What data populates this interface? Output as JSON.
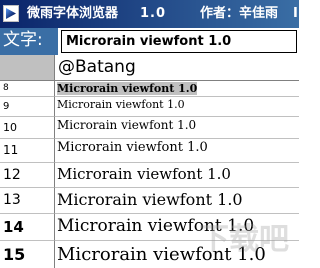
{
  "titlebar": {
    "title": "微雨字体浏览器",
    "version": "1.0",
    "author": "作者：辛佳雨",
    "overflow": "I"
  },
  "text_label": "文字:",
  "text_input_value": "Microrain viewfont 1.0",
  "font_header": "@Batang",
  "rows": [
    {
      "size": "8",
      "sample": "Microrain viewfont 1.0"
    },
    {
      "size": "9",
      "sample": "Microrain viewfont 1.0"
    },
    {
      "size": "10",
      "sample": "Microrain viewfont 1.0"
    },
    {
      "size": "11",
      "sample": "Microrain viewfont 1.0"
    },
    {
      "size": "12",
      "sample": "Microrain viewfont 1.0"
    },
    {
      "size": "13",
      "sample": "Microrain viewfont 1.0"
    },
    {
      "size": "14",
      "sample": "Microrain viewfont 1.0"
    },
    {
      "size": "15",
      "sample": "Microrain viewfont 1.0"
    }
  ],
  "watermark": "下载吧",
  "colors": {
    "titlebar_start": "#0a246a",
    "titlebar_end": "#3a6ea5",
    "label_bg": "#3a6ea5",
    "selection": "#c0c0c0"
  }
}
